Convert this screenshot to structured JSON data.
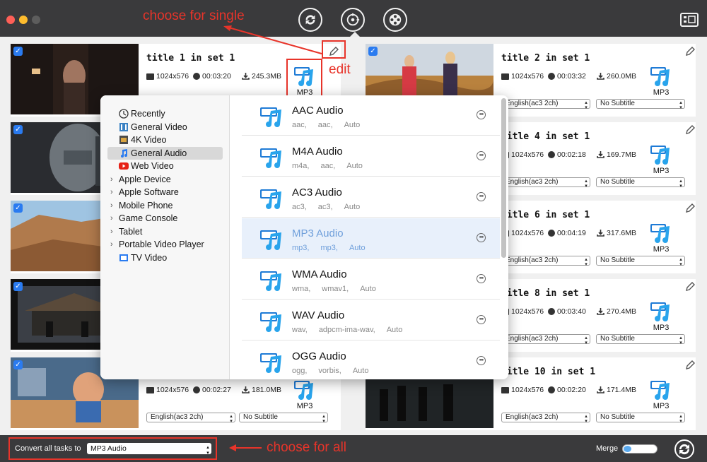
{
  "annotations": {
    "single": "choose for single",
    "edit": "edit",
    "all": "choose for all"
  },
  "cards": [
    {
      "title": "title 1 in set 1",
      "resolution": "1024x576",
      "duration": "00:03:20",
      "size": "245.3MB",
      "format": "MP3",
      "audio": "",
      "subtitle": ""
    },
    {
      "title": "title 2 in set 1",
      "resolution": "1024x576",
      "duration": "00:03:32",
      "size": "260.0MB",
      "format": "MP3",
      "audio": "English(ac3 2ch)",
      "subtitle": "No Subtitle"
    },
    {
      "title": "title 4 in set 1",
      "resolution": "1024x576",
      "duration": "00:02:18",
      "size": "169.7MB",
      "format": "MP3",
      "audio": "English(ac3 2ch)",
      "subtitle": "No Subtitle"
    },
    {
      "title": "title 6 in set 1",
      "resolution": "1024x576",
      "duration": "00:04:19",
      "size": "317.6MB",
      "format": "MP3",
      "audio": "English(ac3 2ch)",
      "subtitle": "No Subtitle"
    },
    {
      "title": "title 8 in set 1",
      "resolution": "1024x576",
      "duration": "00:03:40",
      "size": "270.4MB",
      "format": "MP3",
      "audio": "English(ac3 2ch)",
      "subtitle": "No Subtitle"
    },
    {
      "title": "",
      "resolution": "1024x576",
      "duration": "00:02:27",
      "size": "181.0MB",
      "format": "MP3",
      "audio": "English(ac3 2ch)",
      "subtitle": "No Subtitle"
    },
    {
      "title": "title 10 in set 1",
      "resolution": "1024x576",
      "duration": "00:02:20",
      "size": "171.4MB",
      "format": "MP3",
      "audio": "English(ac3 2ch)",
      "subtitle": "No Subtitle"
    }
  ],
  "categories": [
    {
      "label": "Recently",
      "icon": "clock-icon",
      "expandable": false
    },
    {
      "label": "General Video",
      "icon": "film-icon",
      "expandable": false
    },
    {
      "label": "4K Video",
      "icon": "4k-icon",
      "expandable": false
    },
    {
      "label": "General Audio",
      "icon": "music-note-icon",
      "expandable": false,
      "selected": true
    },
    {
      "label": "Web Video",
      "icon": "youtube-icon",
      "expandable": false
    },
    {
      "label": "Apple Device",
      "expandable": true
    },
    {
      "label": "Apple Software",
      "expandable": true
    },
    {
      "label": "Mobile Phone",
      "expandable": true
    },
    {
      "label": "Game Console",
      "expandable": true
    },
    {
      "label": "Tablet",
      "expandable": true
    },
    {
      "label": "Portable Video Player",
      "expandable": true
    },
    {
      "label": "TV Video",
      "icon": "tv-icon",
      "expandable": false
    }
  ],
  "formats": [
    {
      "name": "AAC Audio",
      "badge": "AAC",
      "params": [
        "aac,",
        "aac,",
        "Auto"
      ]
    },
    {
      "name": "M4A Audio",
      "badge": "M4A",
      "params": [
        "m4a,",
        "aac,",
        "Auto"
      ]
    },
    {
      "name": "AC3 Audio",
      "badge": "AC3",
      "params": [
        "ac3,",
        "ac3,",
        "Auto"
      ]
    },
    {
      "name": "MP3 Audio",
      "badge": "MP3",
      "params": [
        "mp3,",
        "mp3,",
        "Auto"
      ],
      "selected": true
    },
    {
      "name": "WMA Audio",
      "badge": "WMA",
      "params": [
        "wma,",
        "wmav1,",
        "Auto"
      ]
    },
    {
      "name": "WAV Audio",
      "badge": "WAV",
      "params": [
        "wav,",
        "adpcm-ima-wav,",
        "Auto"
      ]
    },
    {
      "name": "OGG Audio",
      "badge": "OGG",
      "params": [
        "ogg,",
        "vorbis,",
        "Auto"
      ]
    }
  ],
  "bottom": {
    "convert_label": "Convert all tasks to",
    "convert_value": "MP3 Audio",
    "merge_label": "Merge",
    "merge_enabled": true
  },
  "colors": {
    "accent": "#2a7bf0",
    "annotation": "#e8342a",
    "titlebar": "#3a3a3c"
  }
}
